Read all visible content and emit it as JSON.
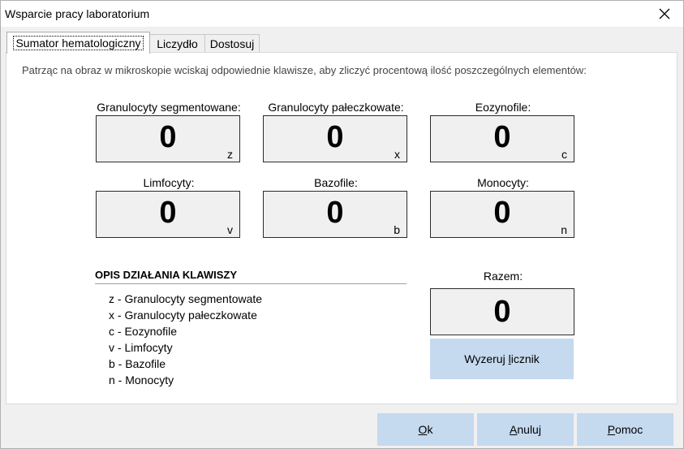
{
  "window": {
    "title": "Wsparcie pracy laboratorium",
    "close_glyph": "✕"
  },
  "tabs": [
    {
      "label": "Sumator hematologiczny",
      "active": true
    },
    {
      "label": "Liczydło",
      "active": false
    },
    {
      "label": "Dostosuj",
      "active": false
    }
  ],
  "instruction": "Patrząc na obraz w mikroskopie wciskaj odpowiednie klawisze, aby zliczyć procentową ilość  poszczególnych elementów:",
  "counters": [
    {
      "label": "Granulocyty segmentowane:",
      "value": "0",
      "key": "z"
    },
    {
      "label": "Granulocyty pałeczkowate:",
      "value": "0",
      "key": "x"
    },
    {
      "label": "Eozynofile:",
      "value": "0",
      "key": "c"
    },
    {
      "label": "Limfocyty:",
      "value": "0",
      "key": "v"
    },
    {
      "label": "Bazofile:",
      "value": "0",
      "key": "b"
    },
    {
      "label": "Monocyty:",
      "value": "0",
      "key": "n"
    }
  ],
  "total": {
    "label": "Razem:",
    "value": "0"
  },
  "legend": {
    "title": "OPIS DZIAŁANIA KLAWISZY",
    "items": [
      "z - Granulocyty segmentowate",
      "x - Granulocyty pałeczkowate",
      "c - Eozynofile",
      "v - Limfocyty",
      "b - Bazofile",
      "n - Monocyty"
    ]
  },
  "reset_button": {
    "label_before": "Wyzeruj ",
    "label_underlined": "l",
    "label_after": "icznik"
  },
  "buttons": {
    "ok": {
      "underlined": "O",
      "rest": "k"
    },
    "cancel": {
      "underlined": "A",
      "rest": "nuluj"
    },
    "help": {
      "underlined": "P",
      "rest": "omoc"
    }
  }
}
